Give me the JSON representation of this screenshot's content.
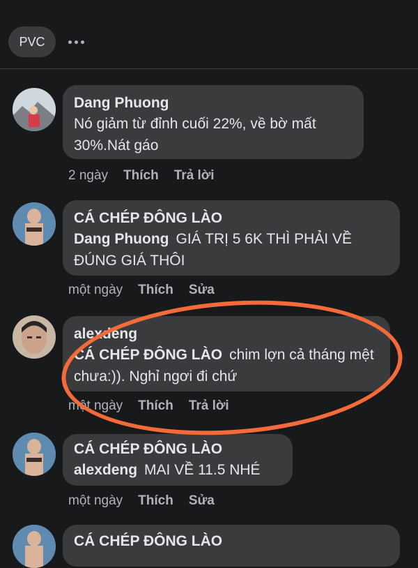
{
  "header": {
    "filter_label": "PVC",
    "more_icon": "more-horizontal-icon"
  },
  "comments": [
    {
      "author": "Dang Phuong",
      "mention": "",
      "text": "Nó giảm từ đỉnh cuối 22%, về bờ mất 30%.Nát gáo",
      "time": "2 ngày",
      "like_label": "Thích",
      "second_action": "Trả lời"
    },
    {
      "author": "CÁ CHÉP ĐÔNG LÀO",
      "mention": "Dang Phuong",
      "text": "GIÁ TRỊ 5 6K THÌ PHẢI VỀ ĐÚNG GIÁ THÔI",
      "time": "một ngày",
      "like_label": "Thích",
      "second_action": "Sửa"
    },
    {
      "author": "alexdeng",
      "mention": "CÁ CHÉP ĐÔNG LÀO",
      "text": "chim lợn cả tháng mệt chưa:)). Nghỉ ngơi đi chứ",
      "time": "một ngày",
      "like_label": "Thích",
      "second_action": "Trả lời"
    },
    {
      "author": "CÁ CHÉP ĐÔNG LÀO",
      "mention": "alexdeng",
      "text": "MAI VỀ 11.5 NHÉ",
      "time": "một ngày",
      "like_label": "Thích",
      "second_action": "Sửa"
    },
    {
      "author": "CÁ CHÉP ĐÔNG LÀO",
      "mention": "",
      "text": "",
      "time": "",
      "like_label": "",
      "second_action": ""
    }
  ],
  "colors": {
    "background": "#18191a",
    "bubble": "#3a3b3c",
    "highlight_stroke": "#f36b3a"
  }
}
